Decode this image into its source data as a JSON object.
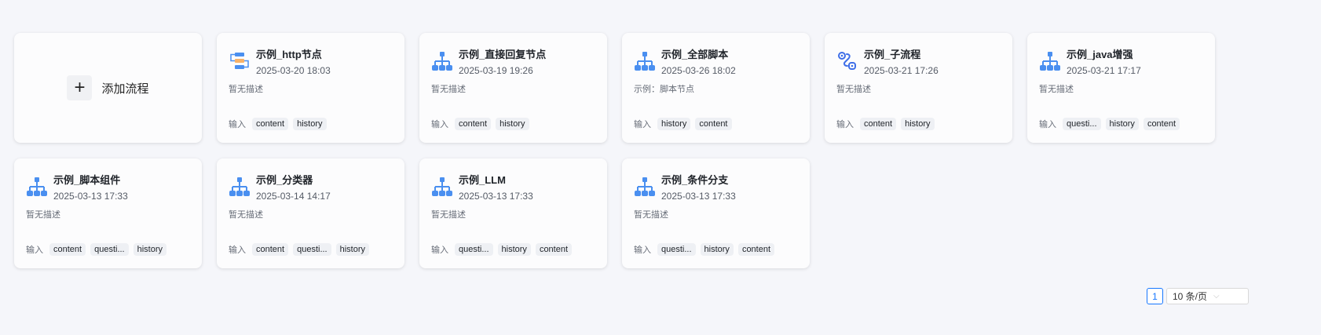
{
  "add_button": {
    "label": "添加流程",
    "icon": "plus-icon"
  },
  "input_label": "输入",
  "cards": [
    {
      "title": "示例_http节点",
      "date": "2025-03-20 18:03",
      "desc": "暂无描述",
      "icon": "http",
      "inputs": [
        "content",
        "history"
      ]
    },
    {
      "title": "示例_直接回复节点",
      "date": "2025-03-19 19:26",
      "desc": "暂无描述",
      "icon": "tree",
      "inputs": [
        "content",
        "history"
      ]
    },
    {
      "title": "示例_全部脚本",
      "date": "2025-03-26 18:02",
      "desc": "示例：脚本节点",
      "icon": "tree",
      "inputs": [
        "history",
        "content"
      ]
    },
    {
      "title": "示例_子流程",
      "date": "2025-03-21 17:26",
      "desc": "暂无描述",
      "icon": "subflow",
      "inputs": [
        "content",
        "history"
      ]
    },
    {
      "title": "示例_java增强",
      "date": "2025-03-21 17:17",
      "desc": "暂无描述",
      "icon": "tree",
      "inputs": [
        "questi...",
        "history",
        "content"
      ]
    },
    {
      "title": "示例_脚本组件",
      "date": "2025-03-13 17:33",
      "desc": "暂无描述",
      "icon": "tree",
      "inputs": [
        "content",
        "questi...",
        "history"
      ]
    },
    {
      "title": "示例_分类器",
      "date": "2025-03-14 14:17",
      "desc": "暂无描述",
      "icon": "tree",
      "inputs": [
        "content",
        "questi...",
        "history"
      ]
    },
    {
      "title": "示例_LLM",
      "date": "2025-03-13 17:33",
      "desc": "暂无描述",
      "icon": "tree",
      "inputs": [
        "questi...",
        "history",
        "content"
      ]
    },
    {
      "title": "示例_条件分支",
      "date": "2025-03-13 17:33",
      "desc": "暂无描述",
      "icon": "tree",
      "inputs": [
        "questi...",
        "history",
        "content"
      ]
    }
  ],
  "pagination": {
    "current_page": "1",
    "page_size": "10 条/页"
  },
  "colors": {
    "accent": "#1677ff",
    "icon_blue": "#4a8ff0",
    "icon_orange": "#f7b26a"
  }
}
